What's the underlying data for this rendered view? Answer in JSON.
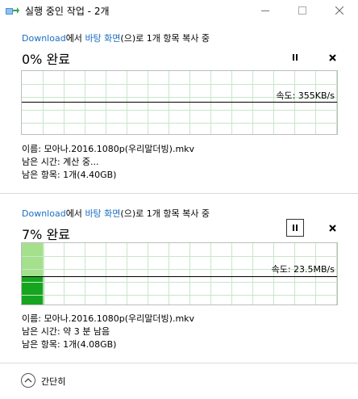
{
  "window": {
    "title": "실행 중인 작업 - 2개",
    "icon": "file-copy-icon"
  },
  "transfers": [
    {
      "source": "Download",
      "mid_text": "에서 ",
      "destination": "바탕 화면",
      "tail_text": "(으)로 1개 항목 복사 중",
      "percent_label": "0% 완료",
      "progress_fraction": 0.0,
      "speed_label": "속도: 355KB/s",
      "name_line": "이름: 모아나.2016.1080p(우리말더빙).mkv",
      "time_line": "남은 시간: 계산 중...",
      "items_line": "남은 항목: 1개(4.40GB)"
    },
    {
      "source": "Download",
      "mid_text": "에서 ",
      "destination": "바탕 화면",
      "tail_text": "(으)로 1개 항목 복사 중",
      "percent_label": "7% 완료",
      "progress_fraction": 0.07,
      "speed_label": "속도: 23.5MB/s",
      "name_line": "이름: 모아나.2016.1080p(우리말더빙).mkv",
      "time_line": "남은 시간: 약 3 분 남음",
      "items_line": "남은 항목: 1개(4.08GB)"
    }
  ],
  "footer": {
    "collapse_label": "간단히"
  },
  "colors": {
    "link": "#1a6ec2",
    "grid": "#c8e6c9",
    "progress_light": "#a5e08c",
    "progress_dark": "#16a51f"
  }
}
